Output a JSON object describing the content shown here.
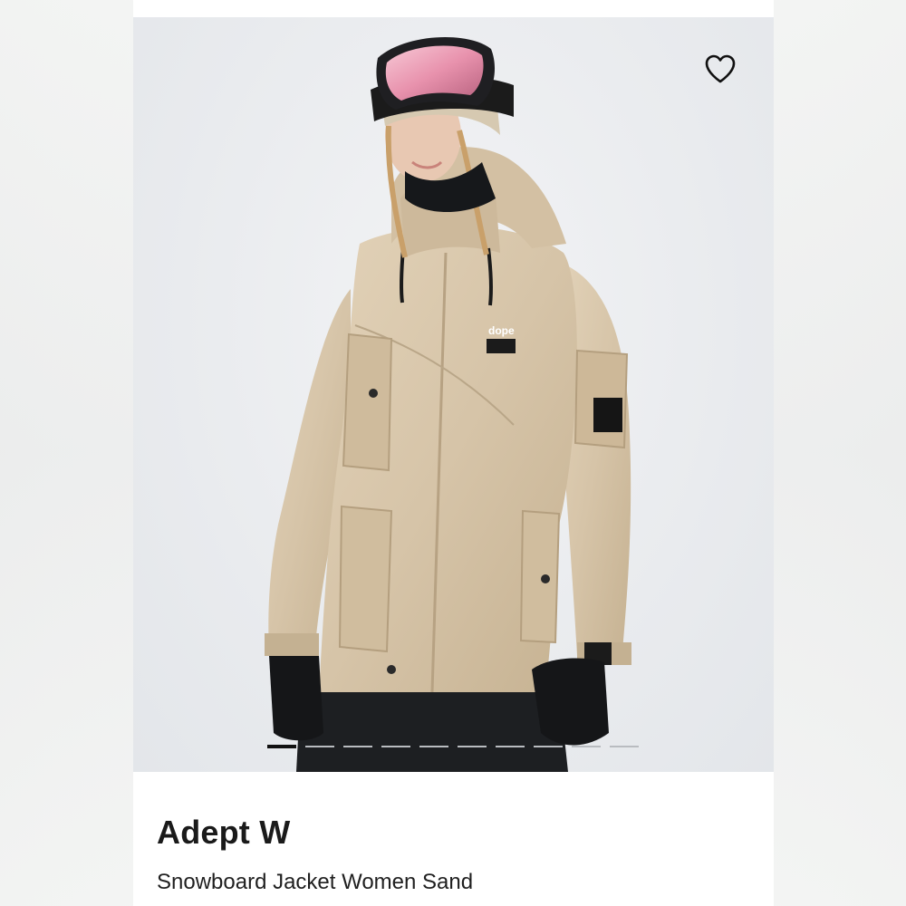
{
  "product": {
    "name": "Adept W",
    "description": "Snowboard Jacket Women Sand",
    "favorite_icon": "heart-outline-icon",
    "image_alt": "Model wearing Adept W snowboard jacket in sand color with pink goggles"
  },
  "gallery": {
    "total_images": 10,
    "active_index": 0
  },
  "colors": {
    "jacket": "#d8c6ab",
    "background": "#e9ebee",
    "indicator_active": "#111111",
    "indicator_inactive": "#b9bcc0"
  }
}
